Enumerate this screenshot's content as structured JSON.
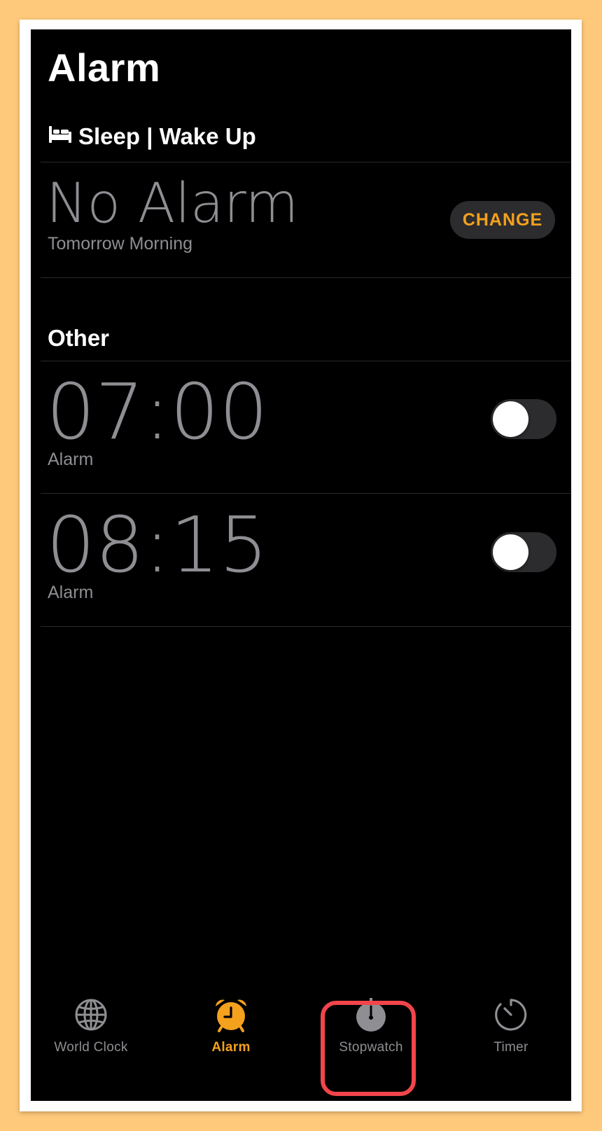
{
  "header": {
    "title": "Alarm"
  },
  "sleep_section": {
    "heading": "Sleep | Wake Up",
    "icon": "bed-icon",
    "alarm_text": "No Alarm",
    "subtitle": "Tomorrow Morning",
    "change_label": "CHANGE"
  },
  "other_section": {
    "heading": "Other"
  },
  "alarms": [
    {
      "time": "07:00",
      "label": "Alarm",
      "enabled": false
    },
    {
      "time": "08:15",
      "label": "Alarm",
      "enabled": false
    }
  ],
  "tabs": [
    {
      "label": "World Clock",
      "icon": "globe-icon",
      "active": false
    },
    {
      "label": "Alarm",
      "icon": "alarm-clock-icon",
      "active": true
    },
    {
      "label": "Stopwatch",
      "icon": "stopwatch-icon",
      "active": false,
      "highlighted": true
    },
    {
      "label": "Timer",
      "icon": "timer-icon",
      "active": false
    }
  ],
  "colors": {
    "accent": "#f4a11e",
    "background": "#000000",
    "secondary_text": "#8e8e93",
    "highlight": "#f2454b",
    "outer_background": "#fec97a"
  }
}
